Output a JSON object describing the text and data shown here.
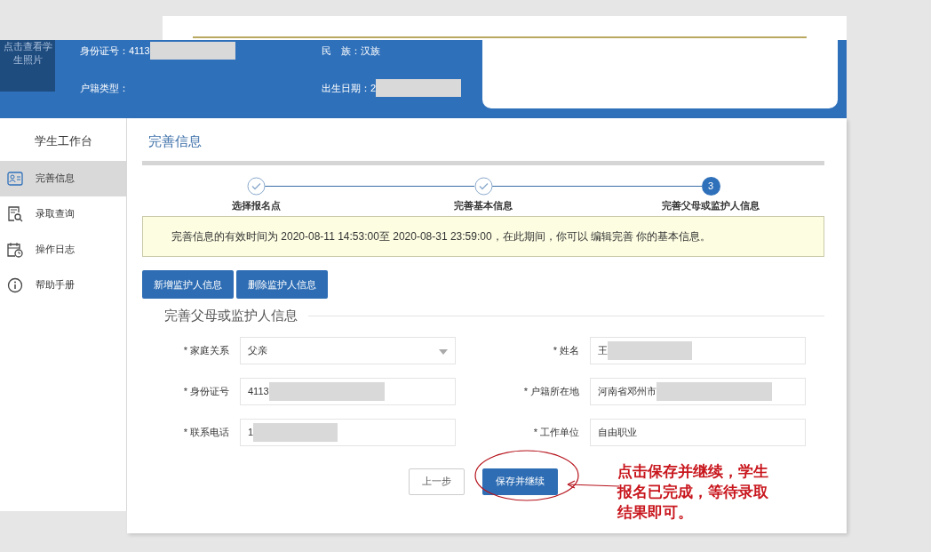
{
  "photo": {
    "caption": "点击查看学生照片"
  },
  "header": {
    "fields": [
      {
        "label": "身份证号：",
        "value": "4113",
        "redacted": true
      },
      {
        "label": "民　族：",
        "value": "汉族",
        "redacted": false
      },
      {
        "label": "户籍类型：",
        "redacted": false
      },
      {
        "label": "出生日期：",
        "value": "2",
        "redacted": true
      }
    ]
  },
  "sidebar": {
    "title": "学生工作台",
    "items": [
      {
        "label": "完善信息",
        "selected": true
      },
      {
        "label": "录取查询",
        "selected": false
      },
      {
        "label": "操作日志",
        "selected": false
      },
      {
        "label": "帮助手册",
        "selected": false
      }
    ]
  },
  "page_title": "完善信息",
  "steps": [
    {
      "label": "选择报名点",
      "done": true
    },
    {
      "label": "完善基本信息",
      "done": true
    },
    {
      "label": "完善父母或监护人信息",
      "done": false,
      "number": "3"
    }
  ],
  "notice": "完善信息的有效时间为 2020-08-11 14:53:00至 2020-08-31 23:59:00，在此期间，你可以 编辑完善 你的基本信息。",
  "actions": [
    "新增监护人信息",
    "删除监护人信息"
  ],
  "section_title": "完善父母或监护人信息",
  "form": [
    {
      "label": "* 家庭关系",
      "kind": "select",
      "value": "父亲",
      "redacted": false
    },
    {
      "label": "* 姓名",
      "kind": "text",
      "value": "王",
      "redacted": true
    },
    {
      "label": "* 身份证号",
      "kind": "text",
      "value": "4113",
      "redacted": true
    },
    {
      "label": "* 户籍所在地",
      "kind": "text",
      "value": "河南省邓州市",
      "redacted": true
    },
    {
      "label": "* 联系电话",
      "kind": "text",
      "value": "1",
      "redacted": true
    },
    {
      "label": "* 工作单位",
      "kind": "text",
      "value": "自由职业",
      "redacted": false
    }
  ],
  "footer_buttons": [
    {
      "label": "上一步",
      "kind": "secondary"
    },
    {
      "label": "保存并继续",
      "kind": "primary"
    }
  ],
  "annotation": {
    "text": "点击保存并继续，学生报名已完成，等待录取结果即可。"
  }
}
